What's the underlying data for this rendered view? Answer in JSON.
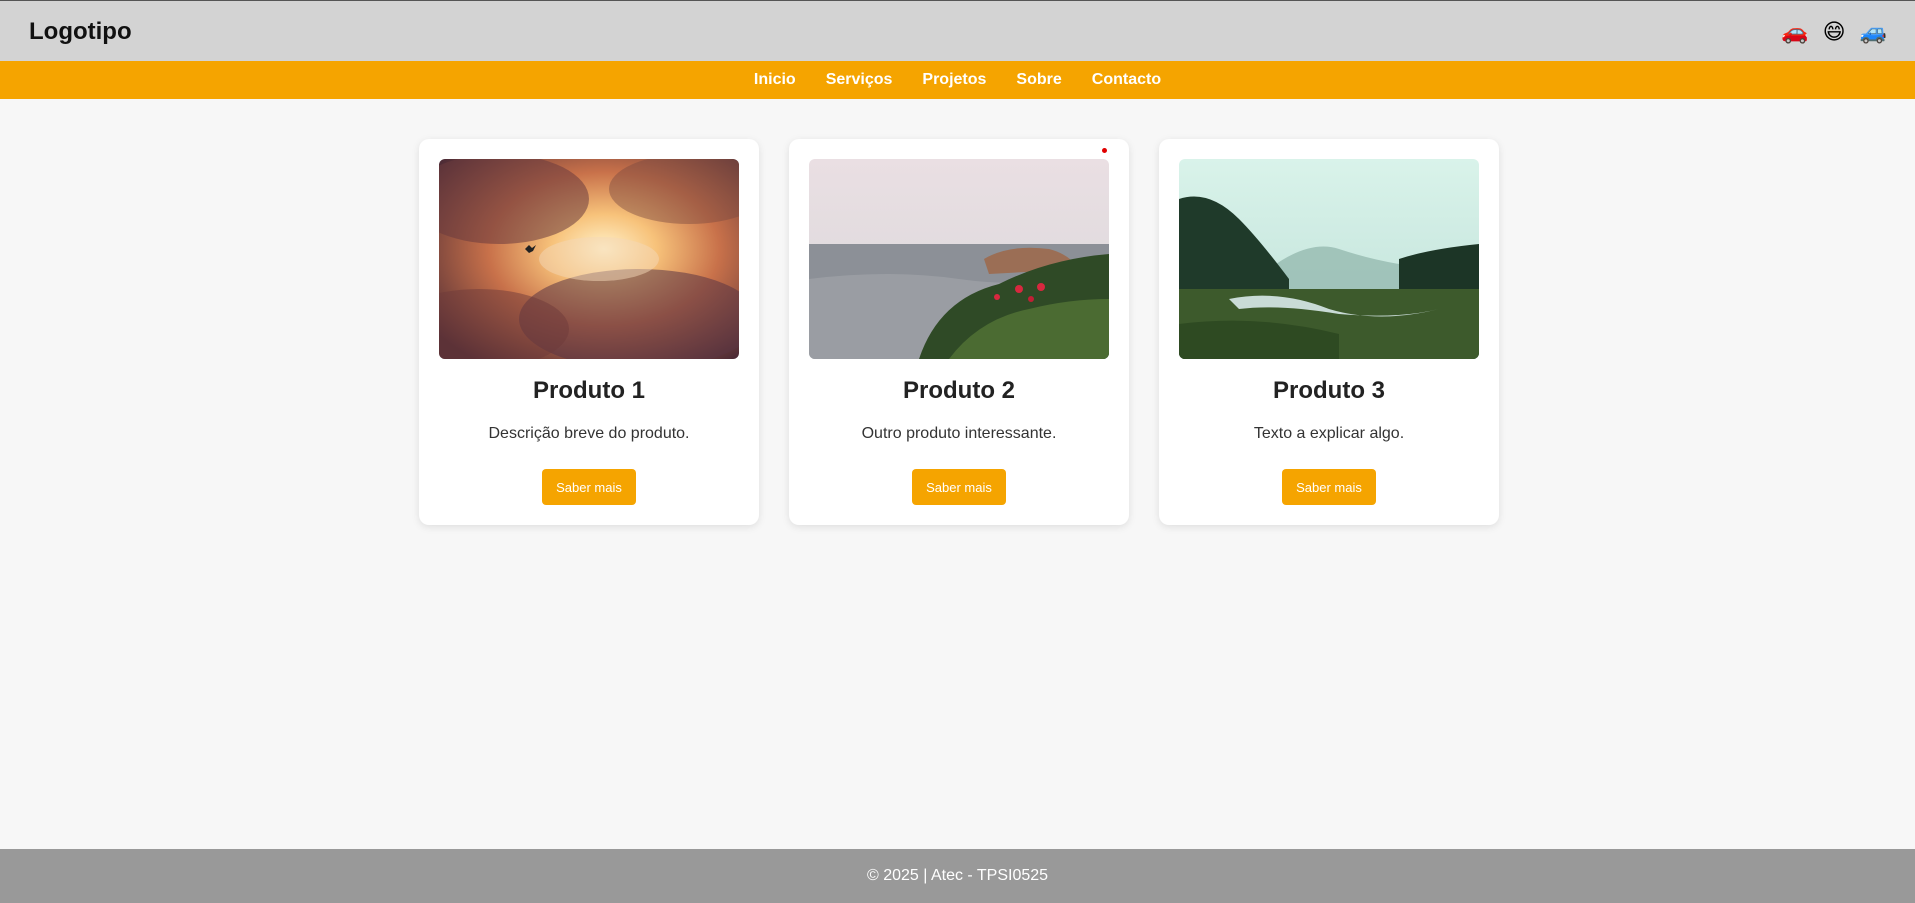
{
  "header": {
    "logo": "Logotipo",
    "icons": [
      {
        "name": "car-icon",
        "glyph": "🚗"
      },
      {
        "name": "smiley-icon",
        "glyph": "😄"
      },
      {
        "name": "suv-icon",
        "glyph": "🚙"
      }
    ]
  },
  "nav": {
    "items": [
      {
        "label": "Inicio"
      },
      {
        "label": "Serviços"
      },
      {
        "label": "Projetos"
      },
      {
        "label": "Sobre"
      },
      {
        "label": "Contacto"
      }
    ]
  },
  "cards": [
    {
      "title": "Produto 1",
      "description": "Descrição breve do produto.",
      "button": "Saber mais"
    },
    {
      "title": "Produto 2",
      "description": "Outro produto interessante.",
      "button": "Saber mais"
    },
    {
      "title": "Produto 3",
      "description": "Texto a explicar algo.",
      "button": "Saber mais"
    }
  ],
  "footer": {
    "text": "© 2025 | Atec - TPSI0525"
  },
  "colors": {
    "accent": "#f5a400",
    "topbar": "#d3d3d3",
    "footer": "#999999",
    "background": "#f7f7f7"
  }
}
